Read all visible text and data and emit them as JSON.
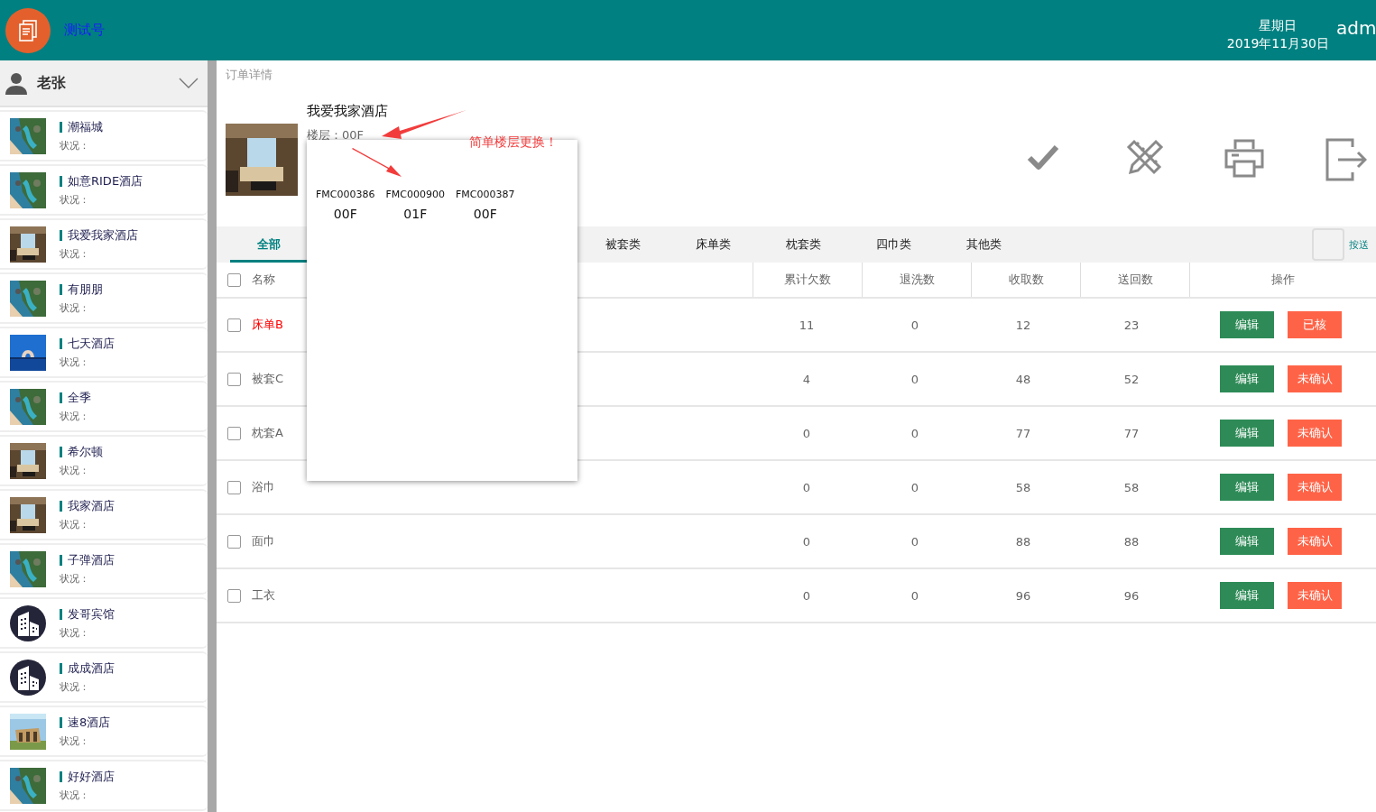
{
  "header": {
    "app_name": "测试号",
    "weekday": "星期日",
    "date": "2019年11月30日",
    "user": "adm"
  },
  "sidebar": {
    "user": "老张",
    "items": [
      {
        "name": "潮福城",
        "status_label": "状况：",
        "kind": "picture"
      },
      {
        "name": "如意RIDE酒店",
        "status_label": "状况：",
        "kind": "picture"
      },
      {
        "name": "我爱我家酒店",
        "status_label": "状况：",
        "kind": "picture"
      },
      {
        "name": "有朋朋",
        "status_label": "状况：",
        "kind": "picture"
      },
      {
        "name": "七天酒店",
        "status_label": "状况：",
        "kind": "picture"
      },
      {
        "name": "全季",
        "status_label": "状况：",
        "kind": "picture"
      },
      {
        "name": "希尔顿",
        "status_label": "状况：",
        "kind": "picture"
      },
      {
        "name": "我家酒店",
        "status_label": "状况：",
        "kind": "picture"
      },
      {
        "name": "子弹酒店",
        "status_label": "状况：",
        "kind": "picture"
      },
      {
        "name": "发哥宾馆",
        "status_label": "状况：",
        "kind": "icon"
      },
      {
        "name": "成成酒店",
        "status_label": "状况：",
        "kind": "icon"
      },
      {
        "name": "速8酒店",
        "status_label": "状况：",
        "kind": "picture"
      },
      {
        "name": "好好酒店",
        "status_label": "状况：",
        "kind": "picture"
      }
    ]
  },
  "page_title": "订单详情",
  "hotel": {
    "name": "我爱我家酒店",
    "floor": "楼层：00F"
  },
  "toolbar": [
    {
      "kind": "check"
    },
    {
      "kind": "tools"
    },
    {
      "kind": "print"
    },
    {
      "kind": "exit"
    }
  ],
  "tabs": [
    {
      "label": "全部",
      "selected": true
    },
    {
      "label": "被套类",
      "selected": false
    },
    {
      "label": "床单类",
      "selected": false
    },
    {
      "label": "枕套类",
      "selected": false
    },
    {
      "label": "四巾类",
      "selected": false
    },
    {
      "label": "其他类",
      "selected": false
    }
  ],
  "filter": {
    "checked": false,
    "label": "按送"
  },
  "table": {
    "all_checked": false,
    "columns": [
      "名称",
      "累计欠数",
      "退洗数",
      "收取数",
      "送回数",
      "操作"
    ],
    "rows": [
      {
        "checked": false,
        "highlight": true,
        "cells": [
          "床单B",
          "11",
          "0",
          "12",
          "23"
        ],
        "edit": "编辑",
        "status": "已核"
      },
      {
        "checked": false,
        "highlight": false,
        "cells": [
          "被套C",
          "4",
          "0",
          "48",
          "52"
        ],
        "edit": "编辑",
        "status": "未确认"
      },
      {
        "checked": false,
        "highlight": false,
        "cells": [
          "枕套A",
          "0",
          "0",
          "77",
          "77"
        ],
        "edit": "编辑",
        "status": "未确认"
      },
      {
        "checked": false,
        "highlight": false,
        "cells": [
          "浴巾",
          "0",
          "0",
          "58",
          "58"
        ],
        "edit": "编辑",
        "status": "未确认"
      },
      {
        "checked": false,
        "highlight": false,
        "cells": [
          "面巾",
          "0",
          "0",
          "88",
          "88"
        ],
        "edit": "编辑",
        "status": "未确认"
      },
      {
        "checked": false,
        "highlight": false,
        "cells": [
          "工衣",
          "0",
          "0",
          "96",
          "96"
        ],
        "edit": "编辑",
        "status": "未确认"
      }
    ]
  },
  "floor_popup": {
    "items": [
      {
        "code": "FMC000386",
        "floor": "00F"
      },
      {
        "code": "FMC000900",
        "floor": "01F"
      },
      {
        "code": "FMC000387",
        "floor": "00F"
      }
    ]
  },
  "annotation": {
    "text": "简单楼层更换！"
  }
}
